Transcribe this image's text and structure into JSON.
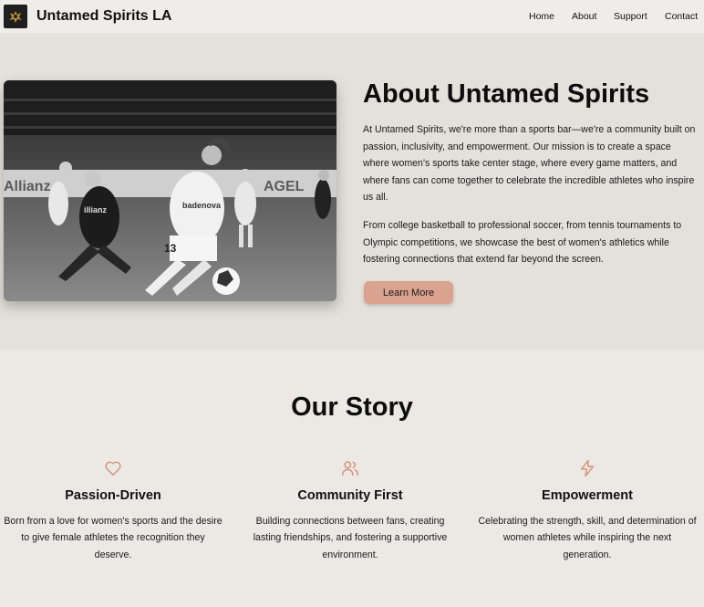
{
  "header": {
    "brand": "Untamed Spirits LA",
    "nav": [
      "Home",
      "About",
      "Support",
      "Contact"
    ]
  },
  "about": {
    "title": "About Untamed Spirits",
    "paragraph1": "At Untamed Spirits, we're more than a sports bar—we're a community built on passion, inclusivity, and empowerment. Our mission is to create a space where women's sports take center stage, where every game matters, and where fans can come together to celebrate the incredible athletes who inspire us all.",
    "paragraph2": "From college basketball to professional soccer, from tennis tournaments to Olympic competitions, we showcase the best of women's athletics while fostering connections that extend far beyond the screen.",
    "button": "Learn More"
  },
  "story": {
    "title": "Our Story",
    "cards": [
      {
        "icon": "heart-icon",
        "title": "Passion-Driven",
        "text": "Born from a love for women's sports and the desire to give female athletes the recognition they deserve."
      },
      {
        "icon": "users-icon",
        "title": "Community First",
        "text": "Building connections between fans, creating lasting friendships, and fostering a supportive environment."
      },
      {
        "icon": "lightning-icon",
        "title": "Empowerment",
        "text": "Celebrating the strength, skill, and determination of women athletes while inspiring the next generation."
      }
    ]
  },
  "colors": {
    "accent": "#d9a38f",
    "icon": "#d4927a",
    "about_bg": "#e4e0da",
    "page_bg": "#ece9e4"
  }
}
